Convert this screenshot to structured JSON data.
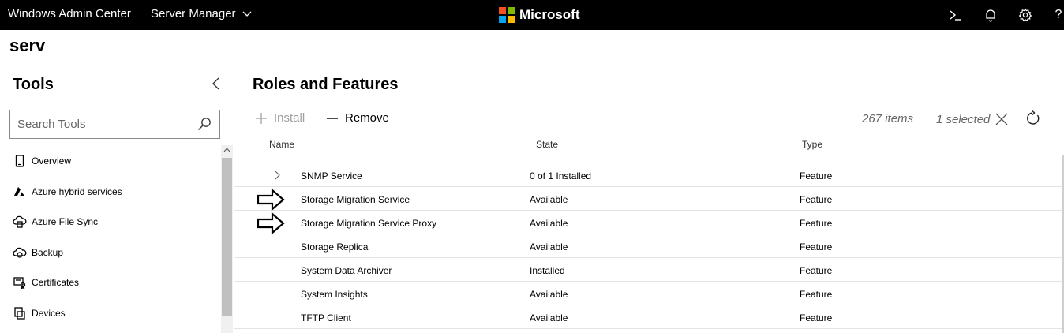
{
  "header": {
    "app_title": "Windows Admin Center",
    "breadcrumb": "Server Manager",
    "brand": "Microsoft",
    "brand_colors": [
      "#F25022",
      "#7FBA00",
      "#00A4EF",
      "#FFB900"
    ],
    "icons": [
      "powershell-icon",
      "notifications-icon",
      "settings-icon",
      "help-icon"
    ],
    "help_label": "?"
  },
  "server_name": "serv",
  "sidebar": {
    "title": "Tools",
    "search_placeholder": "Search Tools",
    "items": [
      {
        "label": "Overview",
        "icon": "overview-icon"
      },
      {
        "label": "Azure hybrid services",
        "icon": "azure-icon"
      },
      {
        "label": "Azure File Sync",
        "icon": "azure-file-sync-icon"
      },
      {
        "label": "Backup",
        "icon": "backup-icon"
      },
      {
        "label": "Certificates",
        "icon": "certificates-icon"
      },
      {
        "label": "Devices",
        "icon": "devices-icon"
      }
    ]
  },
  "main": {
    "title": "Roles and Features",
    "toolbar": {
      "install_label": "Install",
      "remove_label": "Remove",
      "item_count": "267 items",
      "selected_count": "1 selected"
    },
    "columns": {
      "name": "Name",
      "state": "State",
      "type": "Type"
    },
    "rows": [
      {
        "name": "SNMP Service",
        "state": "0 of 1 Installed",
        "type": "Feature",
        "expandable": true,
        "marked": false
      },
      {
        "name": "Storage Migration Service",
        "state": "Available",
        "type": "Feature",
        "expandable": false,
        "marked": true
      },
      {
        "name": "Storage Migration Service Proxy",
        "state": "Available",
        "type": "Feature",
        "expandable": false,
        "marked": true
      },
      {
        "name": "Storage Replica",
        "state": "Available",
        "type": "Feature",
        "expandable": false,
        "marked": false
      },
      {
        "name": "System Data Archiver",
        "state": "Installed",
        "type": "Feature",
        "expandable": false,
        "marked": false
      },
      {
        "name": "System Insights",
        "state": "Available",
        "type": "Feature",
        "expandable": false,
        "marked": false
      },
      {
        "name": "TFTP Client",
        "state": "Available",
        "type": "Feature",
        "expandable": false,
        "marked": false
      }
    ]
  }
}
